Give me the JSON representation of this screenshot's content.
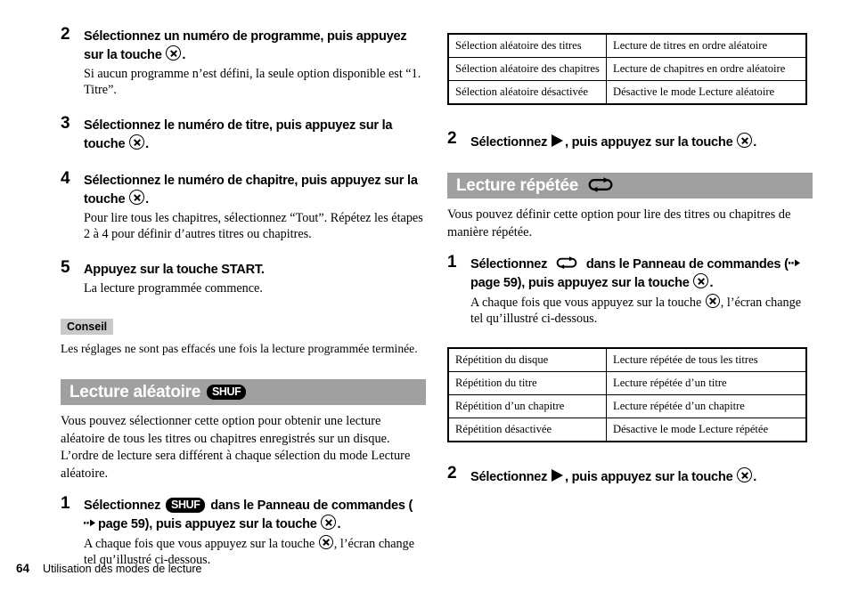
{
  "footer": {
    "page_number": "64",
    "section_title": "Utilisation des modes de lecture"
  },
  "left_column": {
    "steps": [
      {
        "number": "2",
        "title_part1": "Sélectionnez un numéro de programme, puis appuyez sur la touche ",
        "title_part2": ".",
        "body": "Si aucun programme n’est défini, la seule option disponible est “1. Titre”."
      },
      {
        "number": "3",
        "title_part1": "Sélectionnez le numéro de titre, puis appuyez sur la touche ",
        "title_part2": ".",
        "body": ""
      },
      {
        "number": "4",
        "title_part1": "Sélectionnez le numéro de chapitre, puis appuyez sur la touche ",
        "title_part2": ".",
        "body": "Pour lire tous les chapitres, sélectionnez “Tout”. Répétez les étapes 2 à 4 pour définir d’autres titres ou chapitres."
      },
      {
        "number": "5",
        "title_part1": "Appuyez sur la touche START.",
        "title_part2": "",
        "body": "La lecture programmée commence."
      }
    ],
    "tip": {
      "label": "Conseil",
      "text": "Les réglages ne sont pas effacés une fois la lecture programmée terminée."
    },
    "section": {
      "title": "Lecture aléatoire",
      "badge": "SHUF",
      "intro": "Vous pouvez sélectionner cette option pour obtenir une lecture aléatoire de tous les titres ou chapitres enregistrés sur un disque. L’ordre de lecture sera différent à chaque sélection du mode Lecture aléatoire.",
      "step": {
        "number": "1",
        "title_part1": "Sélectionnez ",
        "badge": "SHUF",
        "title_part2": " dans le Panneau de commandes (",
        "link_text": "page 59",
        "title_part3": "), puis appuyez sur la touche ",
        "title_part4": ".",
        "body_part1": "A chaque fois que vous appuyez sur la touche ",
        "body_part2": ", l’écran change tel qu’illustré ci-dessous."
      }
    }
  },
  "right_column": {
    "shuffle_table": {
      "rows": [
        [
          "Sélection aléatoire des titres",
          "Lecture de titres en ordre aléatoire"
        ],
        [
          "Sélection aléatoire des chapitres",
          "Lecture de chapitres en ordre aléatoire"
        ],
        [
          "Sélection aléatoire désactivée",
          "Désactive le mode Lecture aléatoire"
        ]
      ]
    },
    "shuffle_step2": {
      "number": "2",
      "title_part1": "Sélectionnez ",
      "title_part2": ", puis appuyez sur la touche ",
      "title_part3": "."
    },
    "section": {
      "title": "Lecture répétée",
      "icon": "repeat-loop-icon",
      "intro": "Vous pouvez définir cette option pour lire des titres ou chapitres de manière répétée.",
      "step": {
        "number": "1",
        "title_part1": "Sélectionnez ",
        "title_part2": " dans le Panneau de commandes (",
        "link_text": "page 59",
        "title_part3": "), puis appuyez sur la touche ",
        "title_part4": ".",
        "body_part1": "A chaque fois que vous appuyez sur la touche ",
        "body_part2": ", l’écran change tel qu’illustré ci-dessous."
      }
    },
    "repeat_table": {
      "rows": [
        [
          "Répétition du disque",
          "Lecture répétée de tous les titres"
        ],
        [
          "Répétition du titre",
          "Lecture répétée d’un titre"
        ],
        [
          "Répétition d’un chapitre",
          "Lecture répétée d’un chapitre"
        ],
        [
          "Répétition désactivée",
          "Désactive le mode Lecture répétée"
        ]
      ]
    },
    "repeat_step2": {
      "number": "2",
      "title_part1": "Sélectionnez ",
      "title_part2": ", puis appuyez sur la touche ",
      "title_part3": "."
    }
  },
  "colors": {
    "section_bar": "#a0a0a0",
    "tip_label_bg": "#c9c9c9",
    "badge_bg": "#000000",
    "text": "#000000"
  }
}
